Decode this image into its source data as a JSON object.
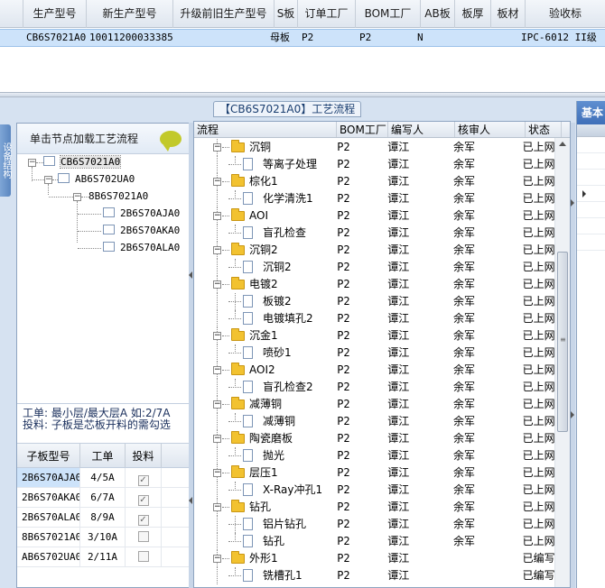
{
  "top_grid": {
    "columns": [
      "生产型号",
      "新生产型号",
      "升级前旧生产型号",
      "S板",
      "订单工厂",
      "BOM工厂",
      "AB板",
      "板厚",
      "板材",
      "验收标"
    ],
    "row": [
      "CB6S7021A0",
      "10011200033385",
      "",
      "母板",
      "P2",
      "P2",
      "N",
      "",
      "",
      "IPC-6012 II级"
    ]
  },
  "process_panel_title": "【CB6S7021A0】工艺流程",
  "side_tab_label": "设备结构",
  "left_panel": {
    "header": "单击节点加载工艺流程",
    "tree": [
      "CB6S7021A0",
      "AB6S702UA0",
      "8B6S7021A0",
      "2B6S70AJA0",
      "2B6S70AKA0",
      "2B6S70ALA0"
    ],
    "info_line1": "工单: 最小层/最大层A 如:2/7A",
    "info_line2": "投料: 子板是芯板开料的需勾选",
    "subgrid": {
      "headers": [
        "子板型号",
        "工单",
        "投料"
      ],
      "rows": [
        {
          "model": "2B6S70AJA0",
          "order": "4/5A",
          "checked": true
        },
        {
          "model": "2B6S70AKA0",
          "order": "6/7A",
          "checked": true
        },
        {
          "model": "2B6S70ALA0",
          "order": "8/9A",
          "checked": true
        },
        {
          "model": "8B6S7021A0",
          "order": "3/10A",
          "checked": false
        },
        {
          "model": "AB6S702UA0",
          "order": "2/11A",
          "checked": false
        }
      ]
    }
  },
  "process_grid": {
    "headers": [
      "流程",
      "BOM工厂",
      "编写人",
      "核审人",
      "状态"
    ],
    "rows": [
      {
        "name": "沉铜",
        "level": 0,
        "bom": "P2",
        "writer": "谭江",
        "reviewer": "余军",
        "status": "已上网"
      },
      {
        "name": "等离子处理",
        "level": 1,
        "bom": "P2",
        "writer": "谭江",
        "reviewer": "余军",
        "status": "已上网"
      },
      {
        "name": "棕化1",
        "level": 0,
        "bom": "P2",
        "writer": "谭江",
        "reviewer": "余军",
        "status": "已上网"
      },
      {
        "name": "化学清洗1",
        "level": 1,
        "bom": "P2",
        "writer": "谭江",
        "reviewer": "余军",
        "status": "已上网"
      },
      {
        "name": "AOI",
        "level": 0,
        "bom": "P2",
        "writer": "谭江",
        "reviewer": "余军",
        "status": "已上网"
      },
      {
        "name": "盲孔检查",
        "level": 1,
        "bom": "P2",
        "writer": "谭江",
        "reviewer": "余军",
        "status": "已上网"
      },
      {
        "name": "沉铜2",
        "level": 0,
        "bom": "P2",
        "writer": "谭江",
        "reviewer": "余军",
        "status": "已上网"
      },
      {
        "name": "沉铜2",
        "level": 1,
        "bom": "P2",
        "writer": "谭江",
        "reviewer": "余军",
        "status": "已上网"
      },
      {
        "name": "电镀2",
        "level": 0,
        "bom": "P2",
        "writer": "谭江",
        "reviewer": "余军",
        "status": "已上网"
      },
      {
        "name": "板镀2",
        "level": 1,
        "bom": "P2",
        "writer": "谭江",
        "reviewer": "余军",
        "status": "已上网"
      },
      {
        "name": "电镀填孔2",
        "level": 1,
        "bom": "P2",
        "writer": "谭江",
        "reviewer": "余军",
        "status": "已上网"
      },
      {
        "name": "沉金1",
        "level": 0,
        "bom": "P2",
        "writer": "谭江",
        "reviewer": "余军",
        "status": "已上网"
      },
      {
        "name": "喷砂1",
        "level": 1,
        "bom": "P2",
        "writer": "谭江",
        "reviewer": "余军",
        "status": "已上网"
      },
      {
        "name": "AOI2",
        "level": 0,
        "bom": "P2",
        "writer": "谭江",
        "reviewer": "余军",
        "status": "已上网"
      },
      {
        "name": "盲孔检查2",
        "level": 1,
        "bom": "P2",
        "writer": "谭江",
        "reviewer": "余军",
        "status": "已上网"
      },
      {
        "name": "减薄铜",
        "level": 0,
        "bom": "P2",
        "writer": "谭江",
        "reviewer": "余军",
        "status": "已上网"
      },
      {
        "name": "减薄铜",
        "level": 1,
        "bom": "P2",
        "writer": "谭江",
        "reviewer": "余军",
        "status": "已上网"
      },
      {
        "name": "陶瓷磨板",
        "level": 0,
        "bom": "P2",
        "writer": "谭江",
        "reviewer": "余军",
        "status": "已上网"
      },
      {
        "name": "抛光",
        "level": 1,
        "bom": "P2",
        "writer": "谭江",
        "reviewer": "余军",
        "status": "已上网"
      },
      {
        "name": "层压1",
        "level": 0,
        "bom": "P2",
        "writer": "谭江",
        "reviewer": "余军",
        "status": "已上网"
      },
      {
        "name": "X-Ray冲孔1",
        "level": 1,
        "bom": "P2",
        "writer": "谭江",
        "reviewer": "余军",
        "status": "已上网"
      },
      {
        "name": "钻孔",
        "level": 0,
        "bom": "P2",
        "writer": "谭江",
        "reviewer": "余军",
        "status": "已上网"
      },
      {
        "name": "铝片钻孔",
        "level": 1,
        "bom": "P2",
        "writer": "谭江",
        "reviewer": "余军",
        "status": "已上网"
      },
      {
        "name": "钻孔",
        "level": 1,
        "bom": "P2",
        "writer": "谭江",
        "reviewer": "余军",
        "status": "已上网"
      },
      {
        "name": "外形1",
        "level": 0,
        "bom": "P2",
        "writer": "谭江",
        "reviewer": "",
        "status": "已编写"
      },
      {
        "name": "铣槽孔1",
        "level": 1,
        "bom": "P2",
        "writer": "谭江",
        "reviewer": "",
        "status": "已编写"
      }
    ]
  },
  "right_panel": {
    "tab": "基本"
  }
}
